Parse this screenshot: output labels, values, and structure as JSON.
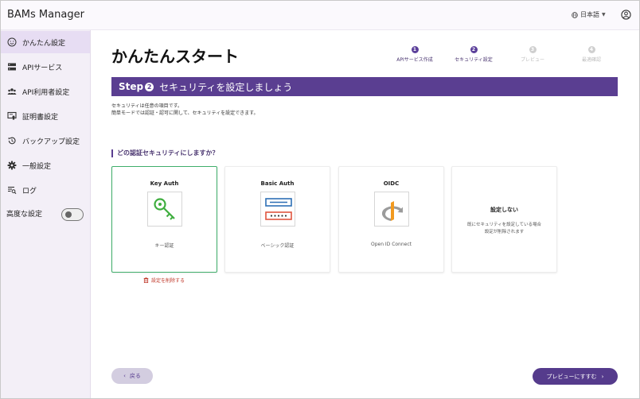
{
  "app": {
    "title": "BAMs Manager"
  },
  "header": {
    "language": "日本語",
    "language_icon": "globe-icon",
    "account_icon": "account-circle-icon"
  },
  "sidebar": {
    "items": [
      {
        "label": "かんたん設定",
        "icon": "smiley-icon",
        "active": true
      },
      {
        "label": "APIサービス",
        "icon": "server-icon",
        "active": false
      },
      {
        "label": "API利用者設定",
        "icon": "users-icon",
        "active": false
      },
      {
        "label": "証明書設定",
        "icon": "certificate-icon",
        "active": false
      },
      {
        "label": "バックアップ設定",
        "icon": "backup-icon",
        "active": false
      },
      {
        "label": "一般設定",
        "icon": "gear-icon",
        "active": false
      },
      {
        "label": "ログ",
        "icon": "log-icon",
        "active": false
      }
    ],
    "advanced_label": "高度な設定",
    "advanced_enabled": false
  },
  "main": {
    "title": "かんたんスタート",
    "stepper": [
      {
        "num": "1",
        "label": "APIサービス作成",
        "done": true
      },
      {
        "num": "2",
        "label": "セキュリティ設定",
        "done": true
      },
      {
        "num": "3",
        "label": "プレビュー",
        "done": false
      },
      {
        "num": "4",
        "label": "最適確認",
        "done": false
      }
    ],
    "banner": {
      "step": "Step",
      "num": "2",
      "text": "セキュリティを設定しましょう"
    },
    "description": [
      "セキュリティは任意の項目です。",
      "簡単モードでは認証・認可に関して、セキュリティを設定できます。"
    ],
    "question": "どの認証セキュリティにしますか？",
    "cards": [
      {
        "title": "Key Auth",
        "subtitle": "キー認証",
        "icon": "key-icon",
        "selected": true
      },
      {
        "title": "Basic Auth",
        "subtitle": "ベーシック認証",
        "icon": "login-form-icon",
        "selected": false
      },
      {
        "title": "OIDC",
        "subtitle": "Open ID Connect",
        "icon": "openid-icon",
        "selected": false
      }
    ],
    "none_card": {
      "title": "設定しない",
      "desc_line1": "既にセキュリティを設定している場合",
      "desc_line2": "設定が削除されます"
    },
    "delete_label": "設定を削除する",
    "back_label": "戻る",
    "next_label": "プレビューにすすむ"
  },
  "colors": {
    "accent": "#5a3e91",
    "selected_border": "#3fae6a",
    "danger": "#c0392b"
  }
}
